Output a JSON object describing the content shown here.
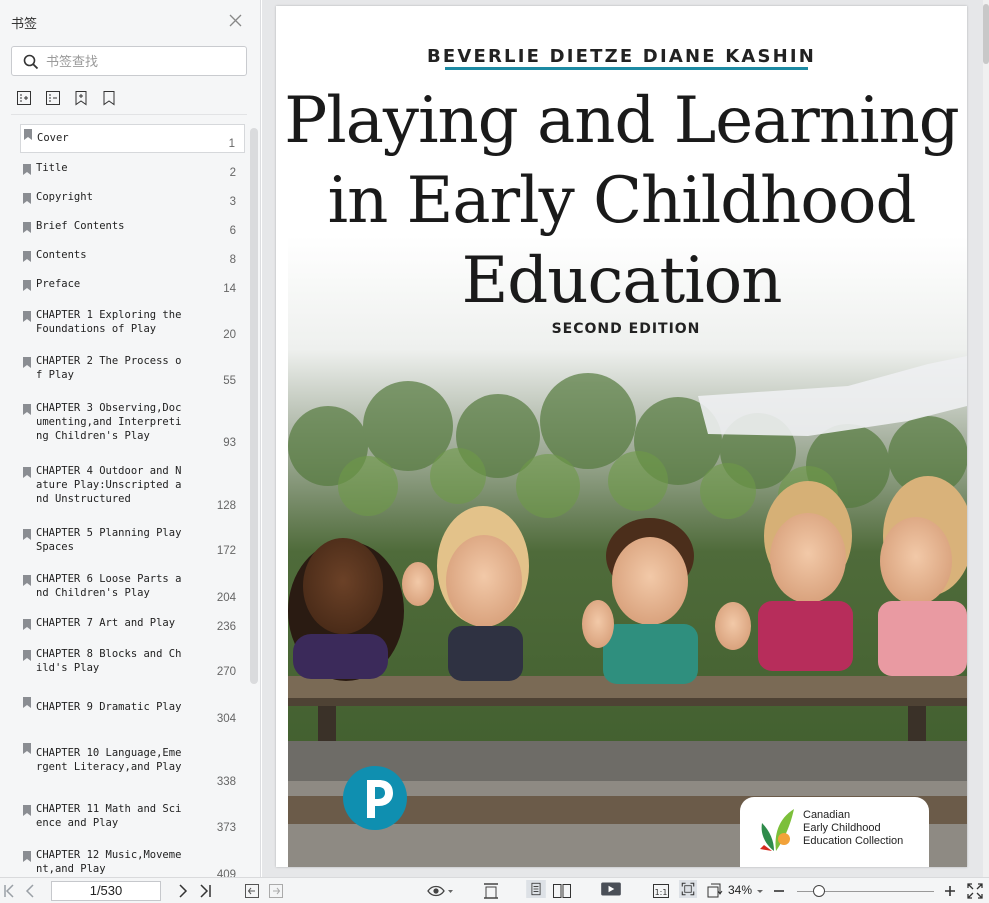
{
  "sidebar": {
    "title": "书签",
    "search_placeholder": "书签查找",
    "bookmarks": [
      {
        "label": "Cover",
        "page": "1"
      },
      {
        "label": "Title",
        "page": "2"
      },
      {
        "label": "Copyright",
        "page": "3"
      },
      {
        "label": "Brief Contents",
        "page": "6"
      },
      {
        "label": "Contents",
        "page": "8"
      },
      {
        "label": "Preface",
        "page": "14"
      },
      {
        "label": "CHAPTER 1 Exploring the Foundations of Play",
        "page": "20"
      },
      {
        "label": "CHAPTER 2 The Process of Play",
        "page": "55"
      },
      {
        "label": "CHAPTER 3 Observing,Documenting,and Interpreting Children's Play",
        "page": "93"
      },
      {
        "label": "CHAPTER 4 Outdoor and Nature Play:Unscripted and Unstructured",
        "page": "128"
      },
      {
        "label": "CHAPTER 5 Planning Play Spaces",
        "page": "172"
      },
      {
        "label": "CHAPTER 6 Loose Parts and Children's Play",
        "page": "204"
      },
      {
        "label": "CHAPTER 7 Art and Play",
        "page": "236"
      },
      {
        "label": "CHAPTER 8 Blocks and Child's Play",
        "page": "270"
      },
      {
        "label": "CHAPTER 9 Dramatic Play",
        "page": "304"
      },
      {
        "label": "CHAPTER 10 Language,Emergent Literacy,and Play",
        "page": "338"
      },
      {
        "label": "CHAPTER 11 Math and Science and Play",
        "page": "373"
      },
      {
        "label": "CHAPTER 12 Music,Movement,and Play",
        "page": "409"
      }
    ]
  },
  "cover": {
    "authors": "BEVERLIE DIETZE   DIANE KASHIN",
    "title_line1": "Playing and Learning",
    "title_line2": "in Early Childhood",
    "title_line3": "Education",
    "edition": "SECOND EDITION",
    "collection_text": "Canadian\nEarly Childhood\nEducation Collection",
    "accent_color": "#1d8aa3"
  },
  "toolbar": {
    "page_indicator": "1/530",
    "zoom": "34%"
  }
}
